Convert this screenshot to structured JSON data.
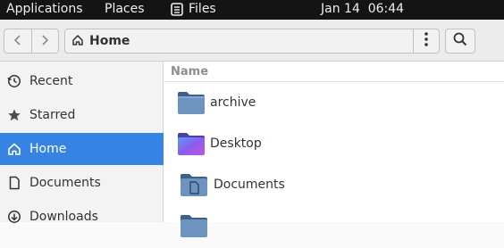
{
  "topbar": {
    "applications": "Applications",
    "places": "Places",
    "files": "Files",
    "clock": "Jan 14  06:44"
  },
  "headerbar": {
    "path_label": "Home"
  },
  "sidebar": {
    "items": [
      {
        "label": "Recent",
        "icon": "clock-icon"
      },
      {
        "label": "Starred",
        "icon": "star-icon"
      },
      {
        "label": "Home",
        "icon": "home-icon"
      },
      {
        "label": "Documents",
        "icon": "document-icon"
      },
      {
        "label": "Downloads",
        "icon": "download-icon"
      }
    ],
    "active": "Home"
  },
  "content": {
    "column_header": "Name",
    "rows": [
      {
        "name": "archive",
        "icon": "folder-icon"
      },
      {
        "name": "Desktop",
        "icon": "desktop-folder-icon"
      },
      {
        "name": "Documents",
        "icon": "documents-folder-icon"
      },
      {
        "name": "",
        "icon": "folder-icon"
      }
    ]
  },
  "colors": {
    "topbar_bg": "#141414",
    "accent": "#3584e4",
    "folder_blue": "#5e81ac",
    "desktop_purple": "#8a5cf0"
  }
}
